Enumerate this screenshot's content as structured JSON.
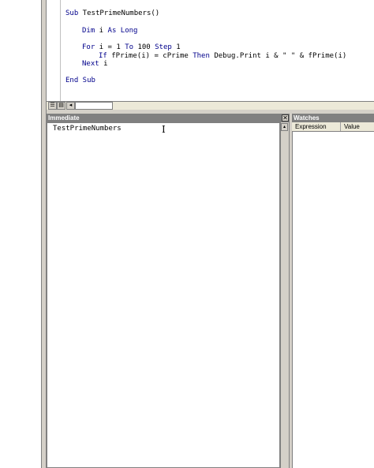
{
  "code": {
    "lines": {
      "sub_decl": "Sub TestPrimeNumbers()",
      "dim": "Dim i As Long",
      "for_loop": "For i = 1 To 100 Step 1",
      "if_line": "If fPrime(i) = cPrime Then Debug.Print i & \" \" & fPrime(i)",
      "next": "Next i",
      "end_sub": "End Sub"
    }
  },
  "immediate": {
    "title": "Immediate",
    "content": "TestPrimeNumbers",
    "close_glyph": "✕"
  },
  "watches": {
    "title": "Watches",
    "columns": [
      "Expression",
      "Value"
    ]
  },
  "icons": {
    "procedure_view": "procedure-view-icon",
    "full_module_view": "full-module-view-icon",
    "scroll_left": "◂",
    "scroll_up": "▴",
    "text_cursor": "I"
  },
  "colors": {
    "keyword": "#00008b",
    "title_bar": "#808080",
    "frame": "#d4d0c8"
  }
}
